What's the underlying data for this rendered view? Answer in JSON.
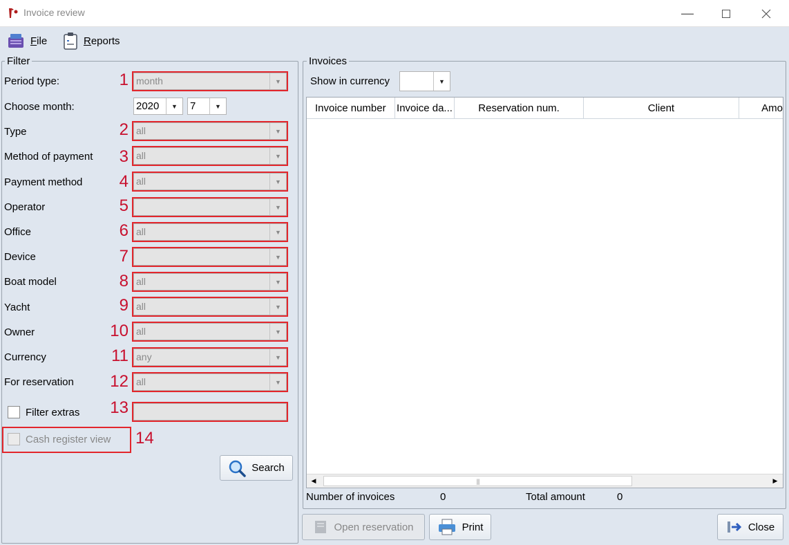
{
  "window": {
    "title": "Invoice review"
  },
  "menu": {
    "file": "File",
    "reports": "Reports"
  },
  "filter": {
    "legend": "Filter",
    "rows": [
      {
        "label": "Period type:",
        "num": "1",
        "value": "month"
      },
      {
        "label": "Choose month:",
        "num": "",
        "value": ""
      },
      {
        "label": "Type",
        "num": "2",
        "value": "all"
      },
      {
        "label": "Method of payment",
        "num": "3",
        "value": "all"
      },
      {
        "label": "Payment method",
        "num": "4",
        "value": "all"
      },
      {
        "label": "Operator",
        "num": "5",
        "value": ""
      },
      {
        "label": "Office",
        "num": "6",
        "value": "all"
      },
      {
        "label": "Device",
        "num": "7",
        "value": ""
      },
      {
        "label": "Boat model",
        "num": "8",
        "value": "all"
      },
      {
        "label": "Yacht",
        "num": "9",
        "value": "all"
      },
      {
        "label": "Owner",
        "num": "10",
        "value": "all"
      },
      {
        "label": "Currency",
        "num": "11",
        "value": "any"
      },
      {
        "label": "For reservation",
        "num": "12",
        "value": "all"
      }
    ],
    "year": "2020",
    "month": "7",
    "filter_extras_label": "Filter extras",
    "filter_extras_num": "13",
    "cash_register_label": "Cash register view",
    "cash_register_num": "14",
    "search_label": "Search"
  },
  "invoices": {
    "legend": "Invoices",
    "show_in_currency_label": "Show in currency",
    "currency_value": "",
    "columns": [
      "Invoice number",
      "Invoice da...",
      "Reservation num.",
      "Client",
      "Amo"
    ],
    "number_of_invoices_label": "Number of invoices",
    "number_of_invoices": "0",
    "total_amount_label": "Total amount",
    "total_amount": "0"
  },
  "buttons": {
    "open_reservation": "Open reservation",
    "print": "Print",
    "close": "Close"
  },
  "colors": {
    "highlight": "#e3262c",
    "background": "#dfe6ef"
  }
}
